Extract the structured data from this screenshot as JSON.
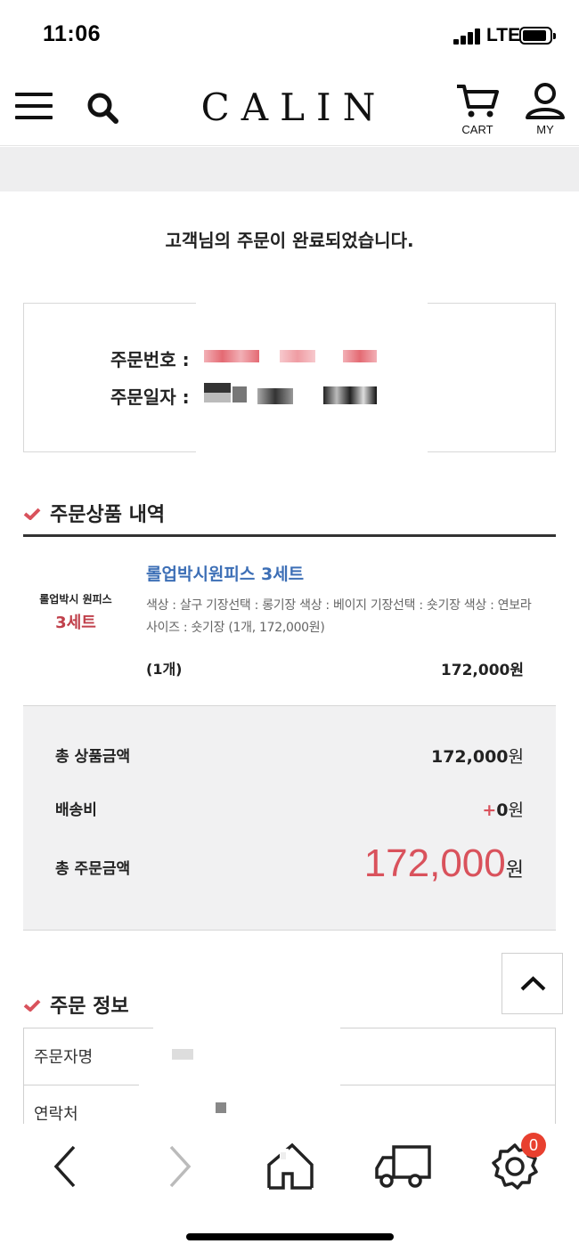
{
  "status_bar": {
    "time": "11:06",
    "network": "LTE"
  },
  "header": {
    "logo": "CALIN",
    "cart_label": "CART",
    "my_label": "MY",
    "icons": [
      "menu-icon",
      "search-icon",
      "cart-icon",
      "user-icon"
    ]
  },
  "complete_message": "고객님의 주문이 완료되었습니다.",
  "order_box": {
    "number_label": "주문번호 :",
    "date_label": "주문일자 :"
  },
  "products_section": {
    "title": "주문상품 내역",
    "item": {
      "thumb_line1": "롤업박시 원피스",
      "thumb_line2": "3세트",
      "name": "롤업박시원피스 3세트",
      "options": "색상 : 살구 기장선택 : 롱기장 색상 : 베이지 기장선택 : 숏기장 색상 : 연보라 사이즈 : 숏기장 (1개, 172,000원)",
      "qty": "(1개)",
      "price": "172,000원"
    }
  },
  "summary": {
    "product_total_label": "총 상품금액",
    "product_total_value": "172,000",
    "shipping_label": "배송비",
    "shipping_plus": "+",
    "shipping_value": "0",
    "order_total_label": "총 주문금액",
    "order_total_value": "172,000",
    "currency": "원"
  },
  "order_info_section": {
    "title": "주문 정보",
    "rows": [
      {
        "label": "주문자명"
      },
      {
        "label": "연락처"
      }
    ]
  },
  "bottom_nav": {
    "icons": [
      "back-arrow-icon",
      "forward-arrow-icon",
      "home-icon",
      "truck-icon",
      "gear-icon"
    ],
    "badge_count": "0"
  },
  "colors": {
    "accent_red": "#d9525c",
    "link_blue": "#3d6fb6",
    "badge_red": "#e8402f"
  }
}
